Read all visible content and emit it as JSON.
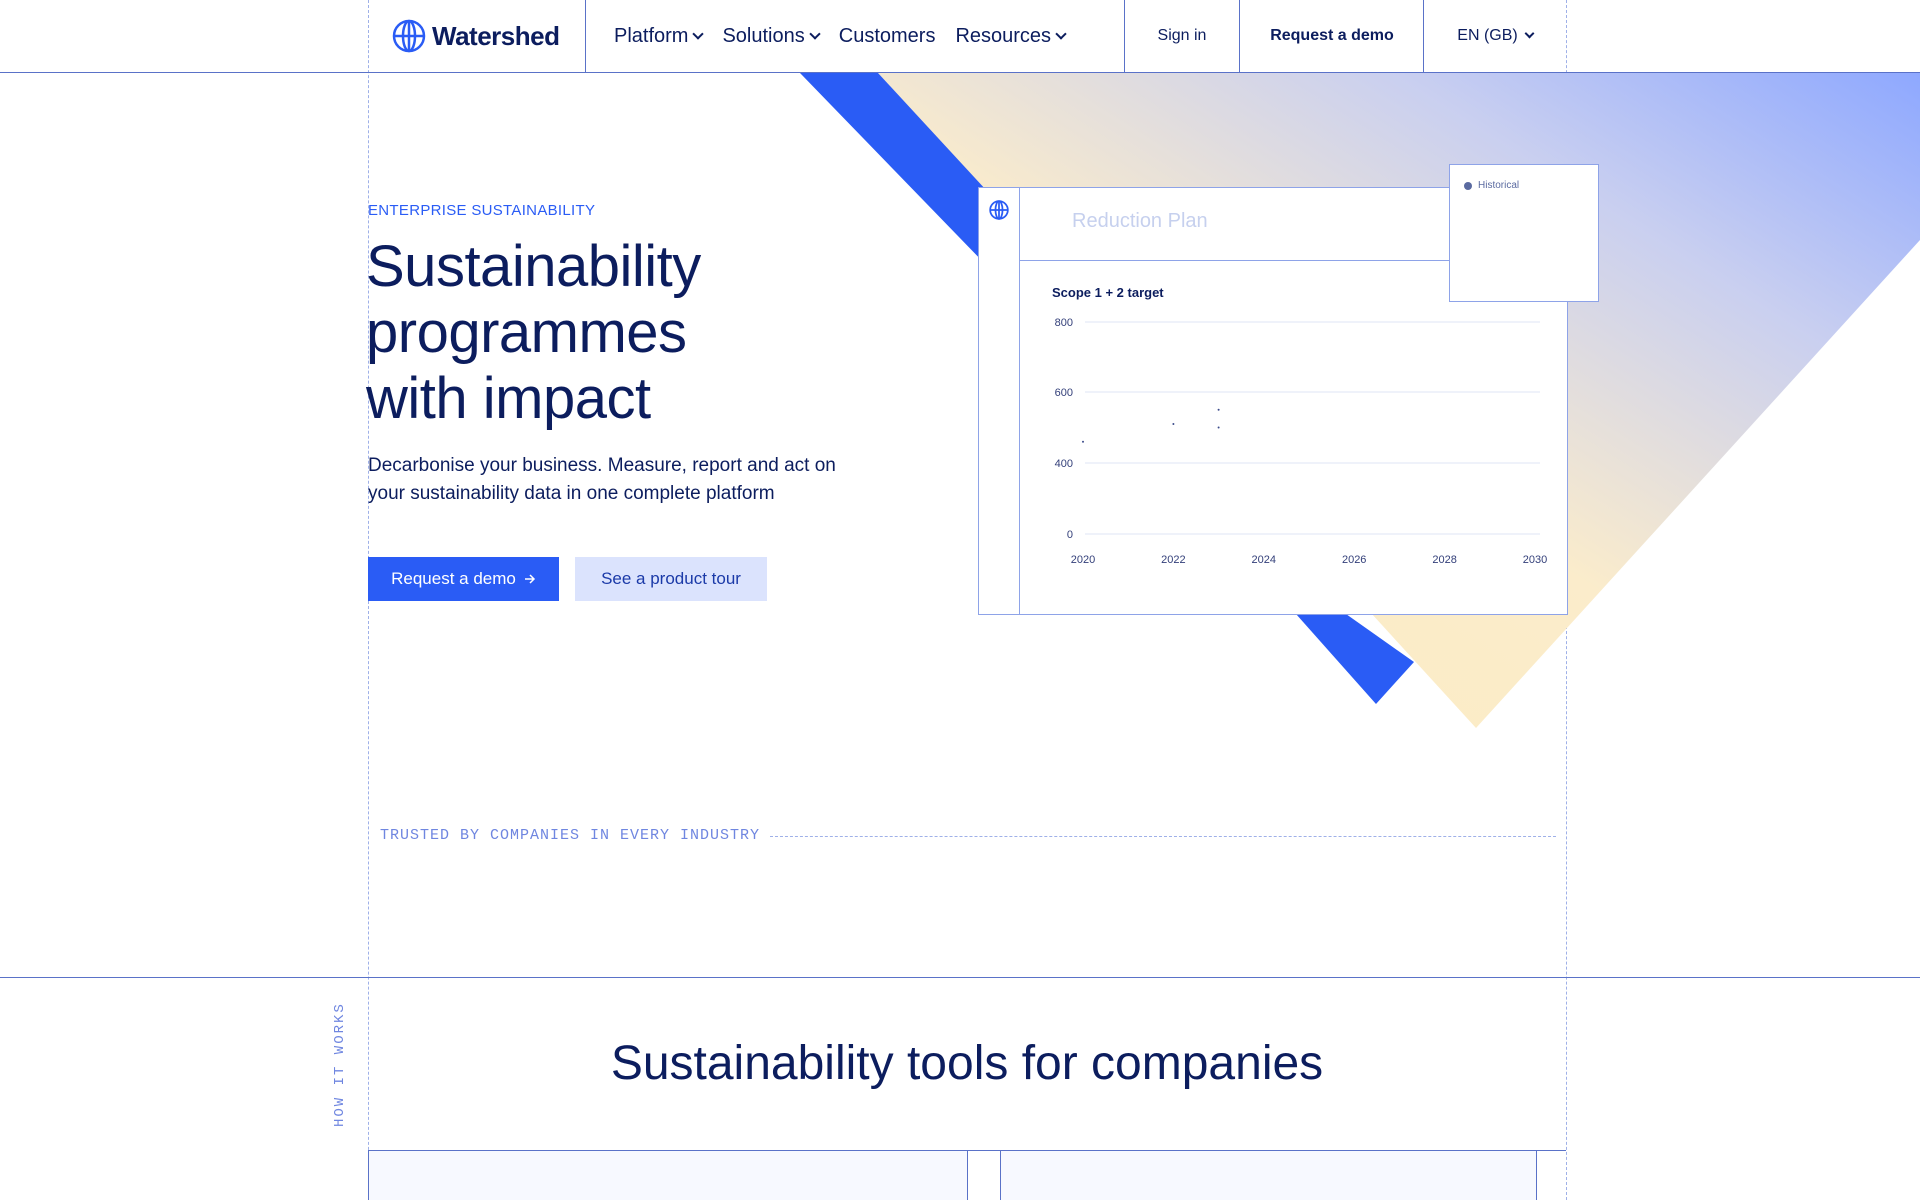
{
  "nav": {
    "logo_text": "Watershed",
    "menu": [
      {
        "label": "Platform",
        "has_dropdown": true
      },
      {
        "label": "Solutions",
        "has_dropdown": true
      },
      {
        "label": "Customers",
        "has_dropdown": false
      },
      {
        "label": "Resources",
        "has_dropdown": true
      }
    ],
    "sign_in": "Sign in",
    "request_demo": "Request a demo",
    "language": "EN (GB)"
  },
  "hero": {
    "eyebrow": "ENTERPRISE SUSTAINABILITY",
    "headline_line1": "Sustainability",
    "headline_line2": "programmes",
    "headline_line3": "with impact",
    "subtitle": "Decarbonise your business. Measure, report and act on your sustainability data in one complete platform",
    "primary_button": "Request a demo",
    "secondary_button": "See a product tour"
  },
  "card": {
    "title": "Reduction Plan",
    "legend_label": "Historical"
  },
  "chart_data": {
    "type": "scatter",
    "title": "Scope 1 + 2 target",
    "xlabel": "",
    "ylabel": "",
    "x_ticks": [
      "2020",
      "2022",
      "2024",
      "2026",
      "2028",
      "2030"
    ],
    "y_ticks": [
      "800",
      "600",
      "400",
      "0"
    ],
    "xlim": [
      2020,
      2030
    ],
    "ylim": [
      0,
      800
    ],
    "grid": true,
    "legend": "top-right",
    "series": [
      {
        "name": "Historical",
        "points": [
          [
            2020,
            460
          ],
          [
            2022,
            510
          ],
          [
            2023,
            550
          ],
          [
            2023,
            500
          ]
        ]
      }
    ]
  },
  "trusted": {
    "label": "TRUSTED BY COMPANIES IN EVERY INDUSTRY"
  },
  "how": {
    "side_label": "HOW IT WORKS",
    "title": "Sustainability tools for companies"
  },
  "colors": {
    "brand_blue": "#2a5cf5",
    "navy": "#0c1d5e",
    "pale_blue": "#dbe3fd",
    "accent_yellow": "#fbeec6"
  },
  "icons": {
    "logo": "globe-icon",
    "arrow": "arrow-right-icon",
    "dropdown": "chevron-down-icon"
  }
}
